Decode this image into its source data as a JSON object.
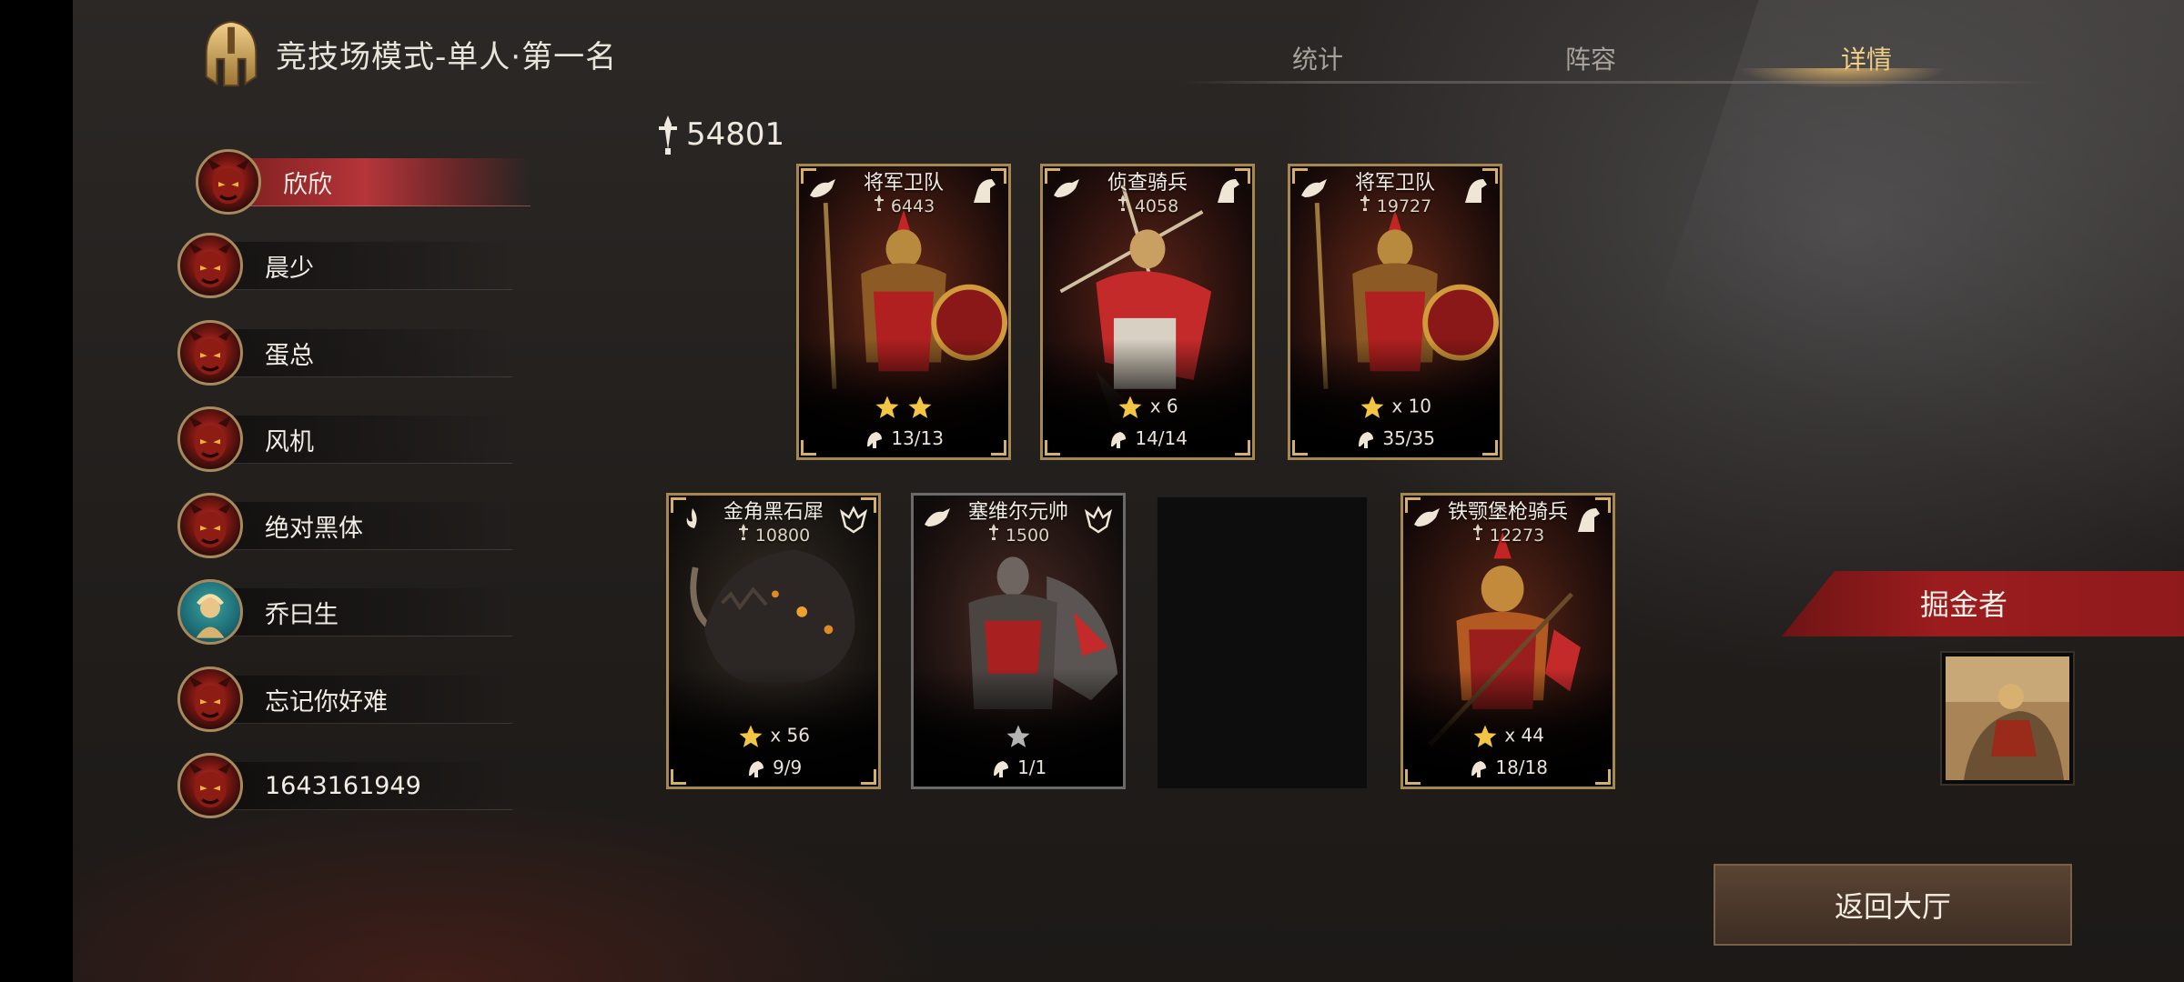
{
  "header": {
    "title": "竞技场模式-单人·第一名",
    "tabs": [
      {
        "label": "统计"
      },
      {
        "label": "阵容"
      },
      {
        "label": "详情"
      }
    ]
  },
  "players": [
    {
      "name": "欣欣"
    },
    {
      "name": "晨少"
    },
    {
      "name": "蛋总"
    },
    {
      "name": "风机"
    },
    {
      "name": "绝对黑体"
    },
    {
      "name": "乔曰生"
    },
    {
      "name": "忘记你好难"
    },
    {
      "name": "1643161949"
    }
  ],
  "total_power": "54801",
  "cards": [
    {
      "name": "将军卫队",
      "power": "6443",
      "stars": 2,
      "rank_text": "",
      "troops": "13/13"
    },
    {
      "name": "侦查骑兵",
      "power": "4058",
      "stars": 1,
      "rank_text": "x 6",
      "troops": "14/14"
    },
    {
      "name": "将军卫队",
      "power": "19727",
      "stars": 1,
      "rank_text": "x 10",
      "troops": "35/35"
    },
    {
      "name": "金角黑石犀",
      "power": "10800",
      "stars": 1,
      "rank_text": "x 56",
      "troops": "9/9"
    },
    {
      "name": "塞维尔元帅",
      "power": "1500",
      "stars": 1,
      "rank_text": "",
      "troops": "1/1"
    },
    {
      "name": "铁颚堡枪骑兵",
      "power": "12273",
      "stars": 1,
      "rank_text": "x 44",
      "troops": "18/18"
    }
  ],
  "title_badge": {
    "label": "掘金者"
  },
  "return_button": {
    "label": "返回大厅"
  },
  "colors": {
    "accent_gold": "#f2cf86",
    "active_red": "#b5353a",
    "card_border": "#a6884f"
  }
}
